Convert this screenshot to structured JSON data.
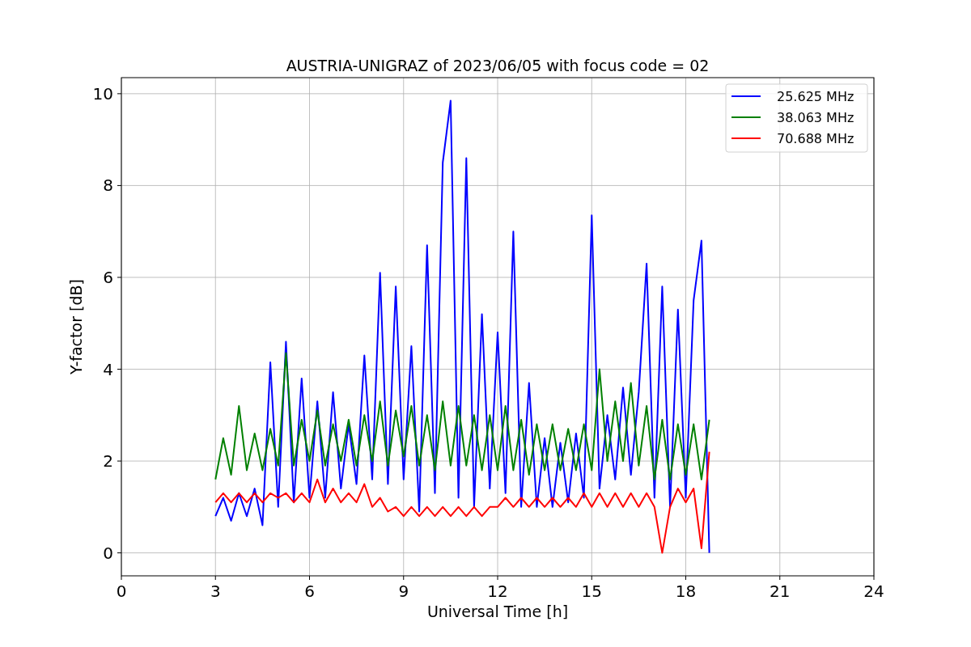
{
  "chart_data": {
    "type": "line",
    "title": "AUSTRIA-UNIGRAZ of 2023/06/05 with focus code = 02",
    "xlabel": "Universal Time [h]",
    "ylabel": "Y-factor [dB]",
    "x": [
      3,
      3.25,
      3.5,
      3.75,
      4,
      4.25,
      4.5,
      4.75,
      5,
      5.25,
      5.5,
      5.75,
      6,
      6.25,
      6.5,
      6.75,
      7,
      7.25,
      7.5,
      7.75,
      8,
      8.25,
      8.5,
      8.75,
      9,
      9.25,
      9.5,
      9.75,
      10,
      10.25,
      10.5,
      10.75,
      11,
      11.25,
      11.5,
      11.75,
      12,
      12.25,
      12.5,
      12.75,
      13,
      13.25,
      13.5,
      13.75,
      14,
      14.25,
      14.5,
      14.75,
      15,
      15.25,
      15.5,
      15.75,
      16,
      16.25,
      16.5,
      16.75,
      17,
      17.25,
      17.5,
      17.75,
      18,
      18.25,
      18.5,
      18.75
    ],
    "series": [
      {
        "name": "25.625 MHz",
        "color": "#0000ff",
        "values": [
          0.8,
          1.2,
          0.7,
          1.3,
          0.8,
          1.4,
          0.6,
          4.15,
          1.0,
          4.6,
          1.1,
          3.8,
          1.2,
          3.3,
          1.2,
          3.5,
          1.4,
          2.8,
          1.5,
          4.3,
          1.6,
          6.1,
          1.5,
          5.8,
          1.6,
          4.5,
          0.9,
          6.7,
          1.3,
          8.5,
          9.85,
          1.2,
          8.6,
          1.0,
          5.2,
          1.4,
          4.8,
          1.3,
          7.0,
          1.0,
          3.7,
          1.0,
          2.5,
          1.0,
          2.4,
          1.1,
          2.6,
          1.2,
          7.35,
          1.4,
          3.0,
          1.6,
          3.6,
          1.7,
          3.5,
          6.3,
          1.2,
          5.8,
          1.0,
          5.3,
          1.2,
          5.5,
          6.8,
          0.0
        ]
      },
      {
        "name": "38.063 MHz",
        "color": "#008000",
        "values": [
          1.6,
          2.5,
          1.7,
          3.2,
          1.8,
          2.6,
          1.8,
          2.7,
          1.9,
          4.35,
          1.9,
          2.9,
          2.0,
          3.1,
          1.9,
          2.8,
          2.0,
          2.9,
          1.9,
          3.0,
          2.0,
          3.3,
          1.9,
          3.1,
          2.1,
          3.2,
          1.9,
          3.0,
          1.8,
          3.3,
          1.9,
          3.2,
          1.9,
          3.0,
          1.8,
          3.0,
          1.8,
          3.2,
          1.8,
          2.9,
          1.7,
          2.8,
          1.8,
          2.8,
          1.8,
          2.7,
          1.8,
          2.8,
          1.8,
          4.0,
          2.0,
          3.3,
          2.0,
          3.7,
          1.9,
          3.2,
          1.6,
          2.9,
          1.6,
          2.8,
          1.7,
          2.8,
          1.6,
          2.9
        ]
      },
      {
        "name": "70.688 MHz",
        "color": "#ff0000",
        "values": [
          1.1,
          1.3,
          1.1,
          1.3,
          1.1,
          1.3,
          1.1,
          1.3,
          1.2,
          1.3,
          1.1,
          1.3,
          1.1,
          1.6,
          1.1,
          1.4,
          1.1,
          1.3,
          1.1,
          1.5,
          1.0,
          1.2,
          0.9,
          1.0,
          0.8,
          1.0,
          0.8,
          1.0,
          0.8,
          1.0,
          0.8,
          1.0,
          0.8,
          1.0,
          0.8,
          1.0,
          1.0,
          1.2,
          1.0,
          1.2,
          1.0,
          1.2,
          1.0,
          1.2,
          1.0,
          1.2,
          1.0,
          1.3,
          1.0,
          1.3,
          1.0,
          1.3,
          1.0,
          1.3,
          1.0,
          1.3,
          1.0,
          0.0,
          1.0,
          1.4,
          1.1,
          1.4,
          0.1,
          2.2
        ]
      }
    ],
    "xlim": [
      0,
      24
    ],
    "ylim": [
      -0.5,
      10.35
    ],
    "xticks": [
      0,
      3,
      6,
      9,
      12,
      15,
      18,
      21,
      24
    ],
    "yticks": [
      0,
      2,
      4,
      6,
      8,
      10
    ],
    "grid": true,
    "legend": true
  }
}
